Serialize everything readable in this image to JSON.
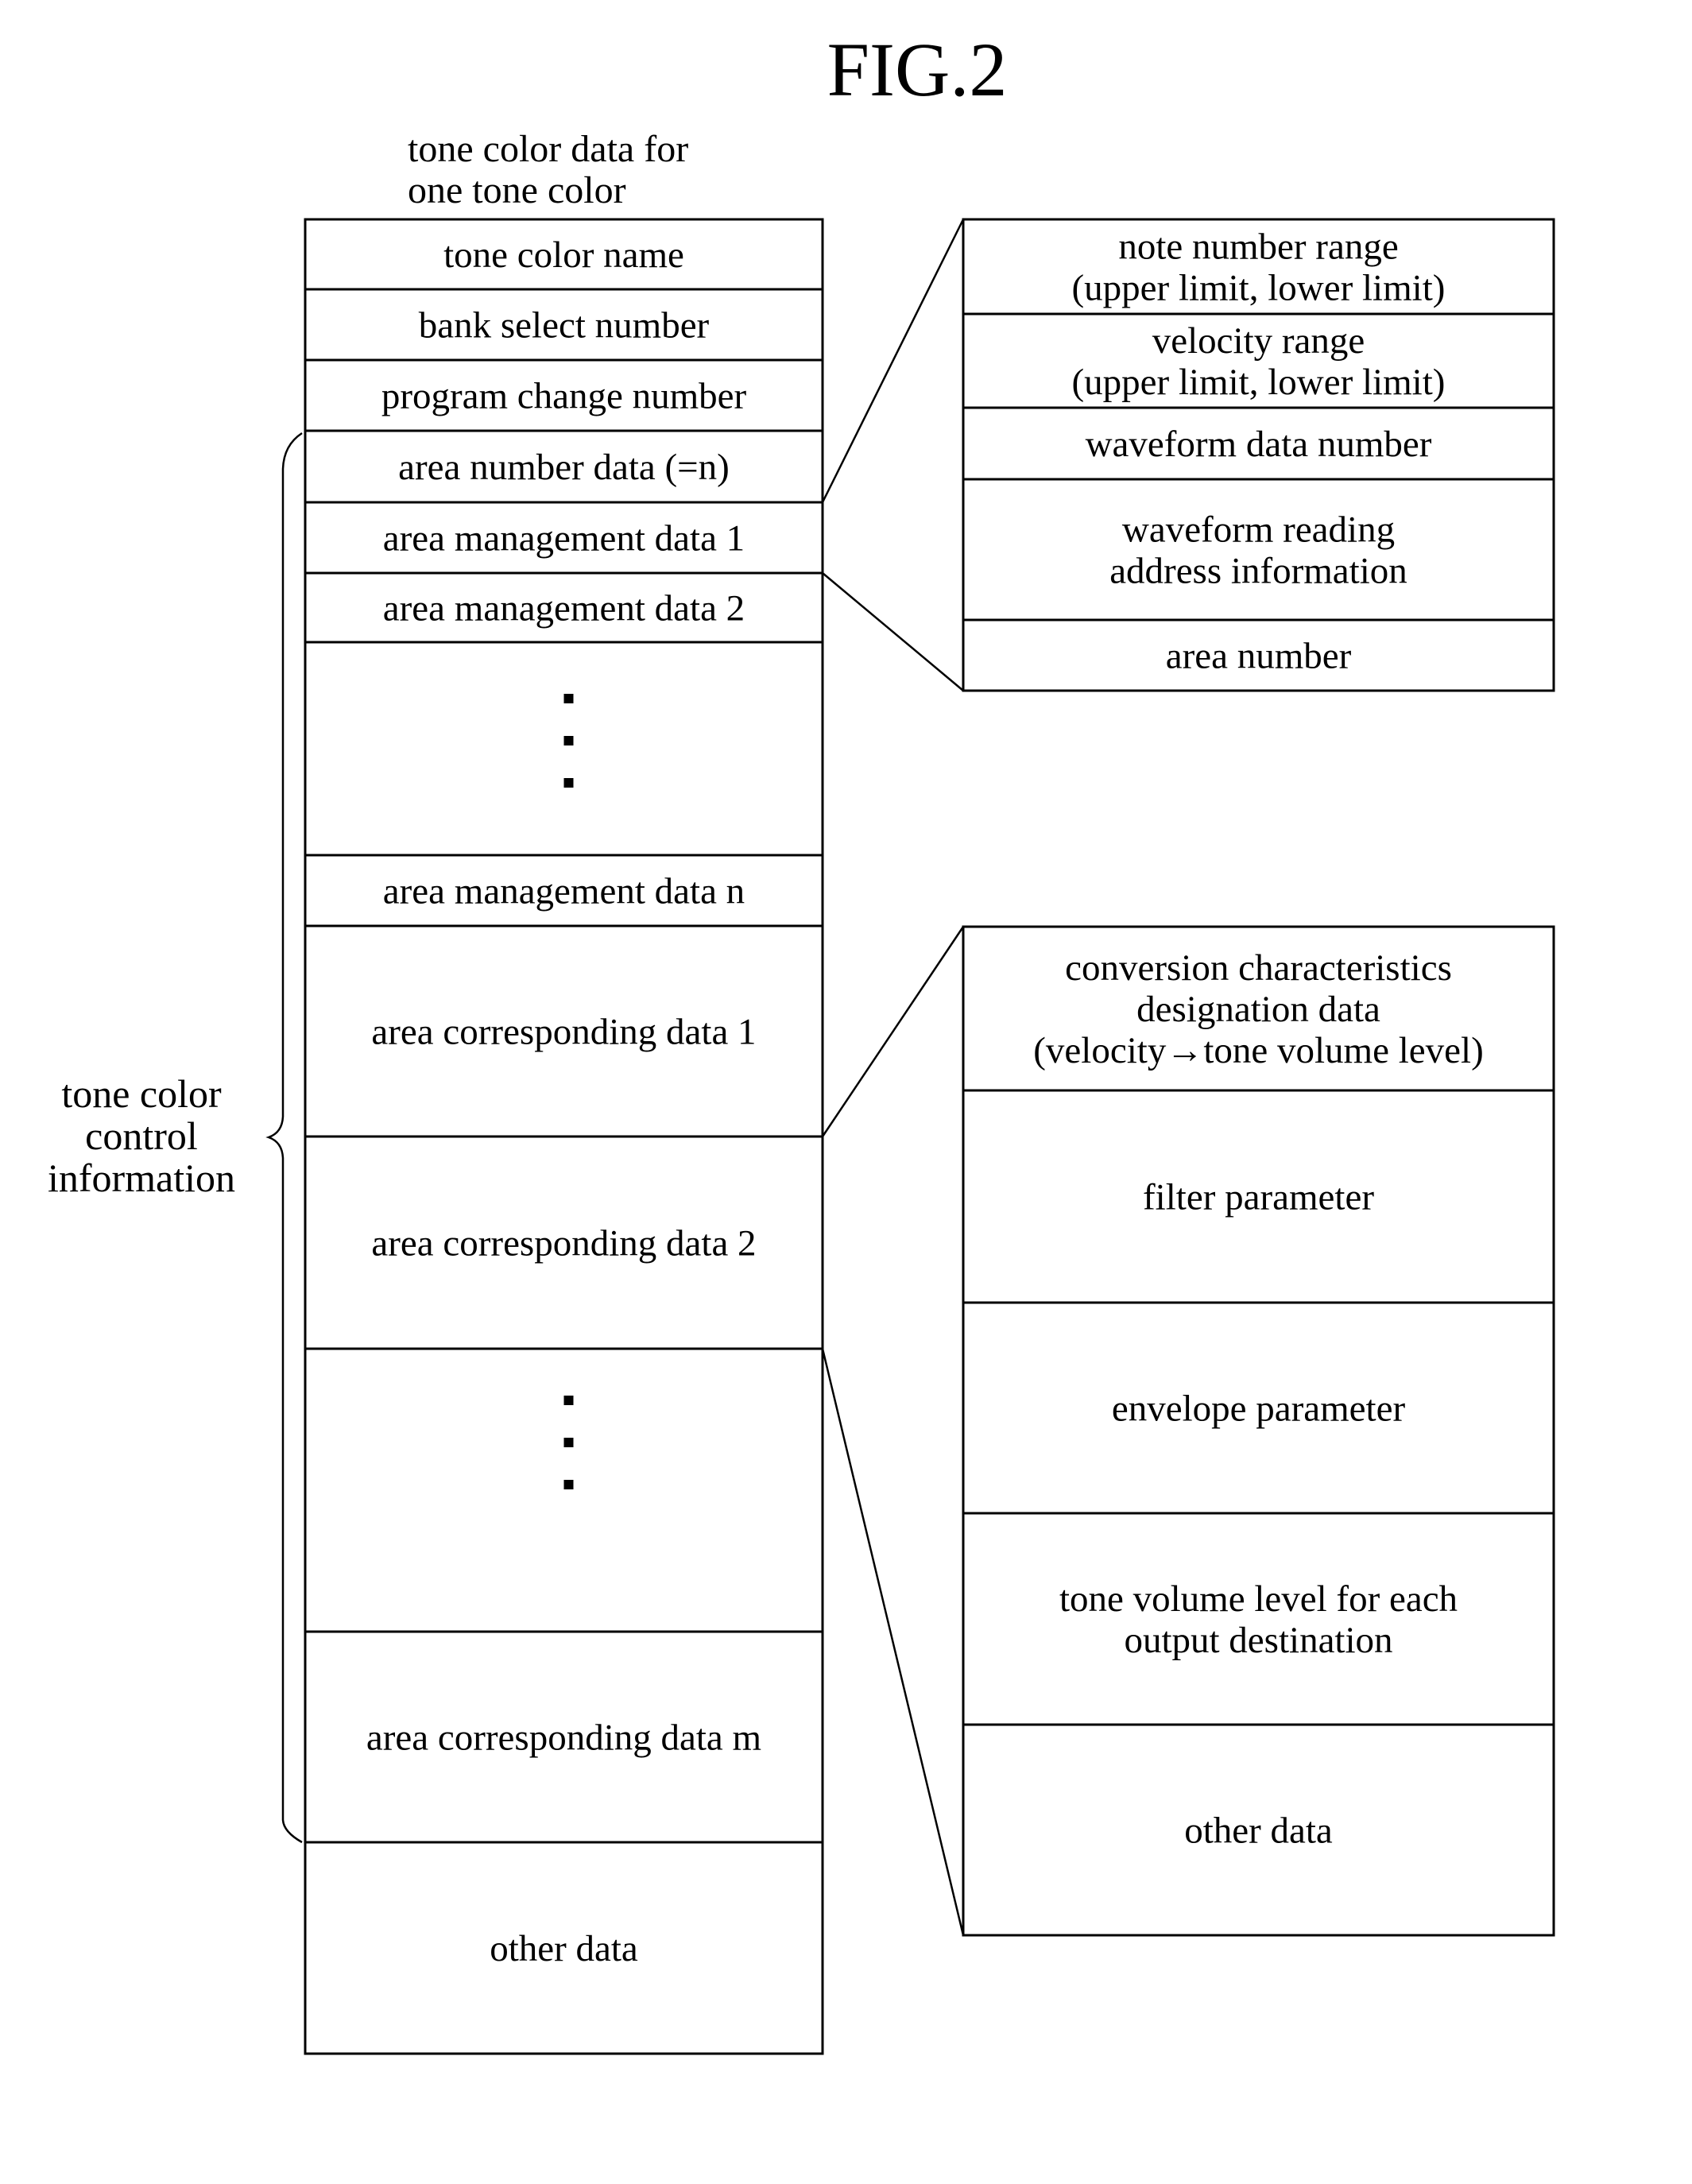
{
  "figure": {
    "title": "FIG.2",
    "header": [
      "tone color data for",
      "one tone color"
    ],
    "side_label": [
      "tone color",
      "control",
      "information"
    ]
  },
  "main_table": {
    "rows": [
      {
        "label": "tone color name"
      },
      {
        "label": "bank select number"
      },
      {
        "label": "program change number"
      },
      {
        "label": "area number data (=n)"
      },
      {
        "label": "area management data 1"
      },
      {
        "label": "area management data 2"
      },
      {
        "label": "⋮",
        "ellipsis": true
      },
      {
        "label": "area management data n"
      },
      {
        "label": "area corresponding data 1"
      },
      {
        "label": "area corresponding data 2"
      },
      {
        "label": "⋮",
        "ellipsis": true
      },
      {
        "label": "area corresponding data m"
      },
      {
        "label": "other data"
      }
    ]
  },
  "area_management_detail": {
    "expands": "area management data 1",
    "rows": [
      {
        "lines": [
          "note number range",
          "(upper limit, lower limit)"
        ]
      },
      {
        "lines": [
          "velocity range",
          "(upper limit, lower limit)"
        ]
      },
      {
        "lines": [
          "waveform data number"
        ]
      },
      {
        "lines": [
          "waveform reading",
          "address information"
        ]
      },
      {
        "lines": [
          "area number"
        ]
      }
    ]
  },
  "area_corresponding_detail": {
    "expands": "area corresponding data 2",
    "rows": [
      {
        "lines": [
          "conversion characteristics",
          "designation data",
          "(velocity→tone volume level)"
        ]
      },
      {
        "lines": [
          "filter parameter"
        ]
      },
      {
        "lines": [
          "envelope parameter"
        ]
      },
      {
        "lines": [
          "tone volume level for each",
          "output destination"
        ]
      },
      {
        "lines": [
          "other data"
        ]
      }
    ]
  }
}
